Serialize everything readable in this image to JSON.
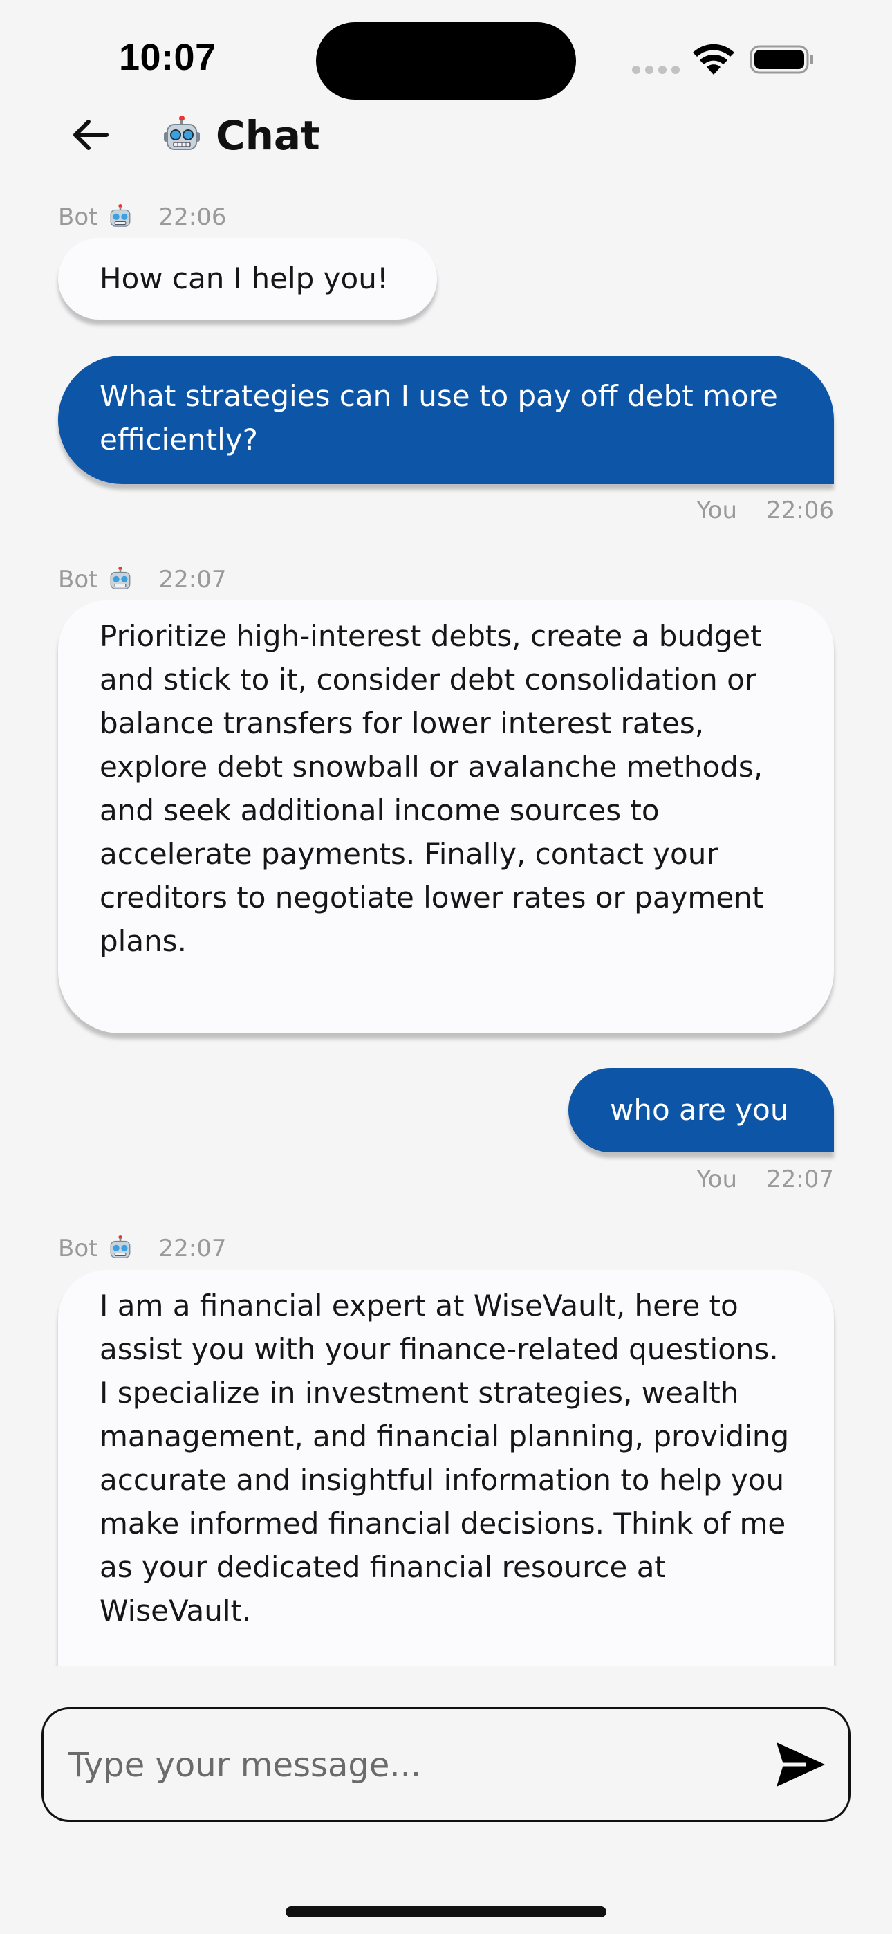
{
  "status_bar": {
    "time": "10:07"
  },
  "header": {
    "back_icon": "arrow-left-icon",
    "emoji_icon": "robot-icon",
    "title": "Chat"
  },
  "messages": [
    {
      "sender": "bot",
      "sender_label": "Bot",
      "time": "22:06",
      "text": "How can I help you!"
    },
    {
      "sender": "user",
      "sender_label": "You",
      "time": "22:06",
      "text": "What strategies can I use to pay off debt more efficiently?"
    },
    {
      "sender": "bot",
      "sender_label": "Bot",
      "time": "22:07",
      "text": "Prioritize high-interest debts, create a budget and stick to it, consider debt consolidation or balance transfers for lower interest rates, explore debt snowball or avalanche methods, and seek additional income sources to accelerate payments. Finally, contact your creditors to negotiate lower rates or payment plans."
    },
    {
      "sender": "user",
      "sender_label": "You",
      "time": "22:07",
      "text": "who are you"
    },
    {
      "sender": "bot",
      "sender_label": "Bot",
      "time": "22:07",
      "text": "I am a financial expert at WiseVault, here to assist you with your finance-related questions. I specialize in investment strategies, wealth management, and financial planning, providing accurate and insightful information to help you make informed financial decisions.  Think of me as your dedicated financial resource at WiseVault."
    }
  ],
  "composer": {
    "placeholder": "Type your message...",
    "value": "",
    "send_icon": "send-icon"
  },
  "colors": {
    "background": "#f5f5f5",
    "user_bubble": "#0d55a6",
    "bot_bubble": "#fbfbfd",
    "meta_text": "#9a9a9a"
  }
}
